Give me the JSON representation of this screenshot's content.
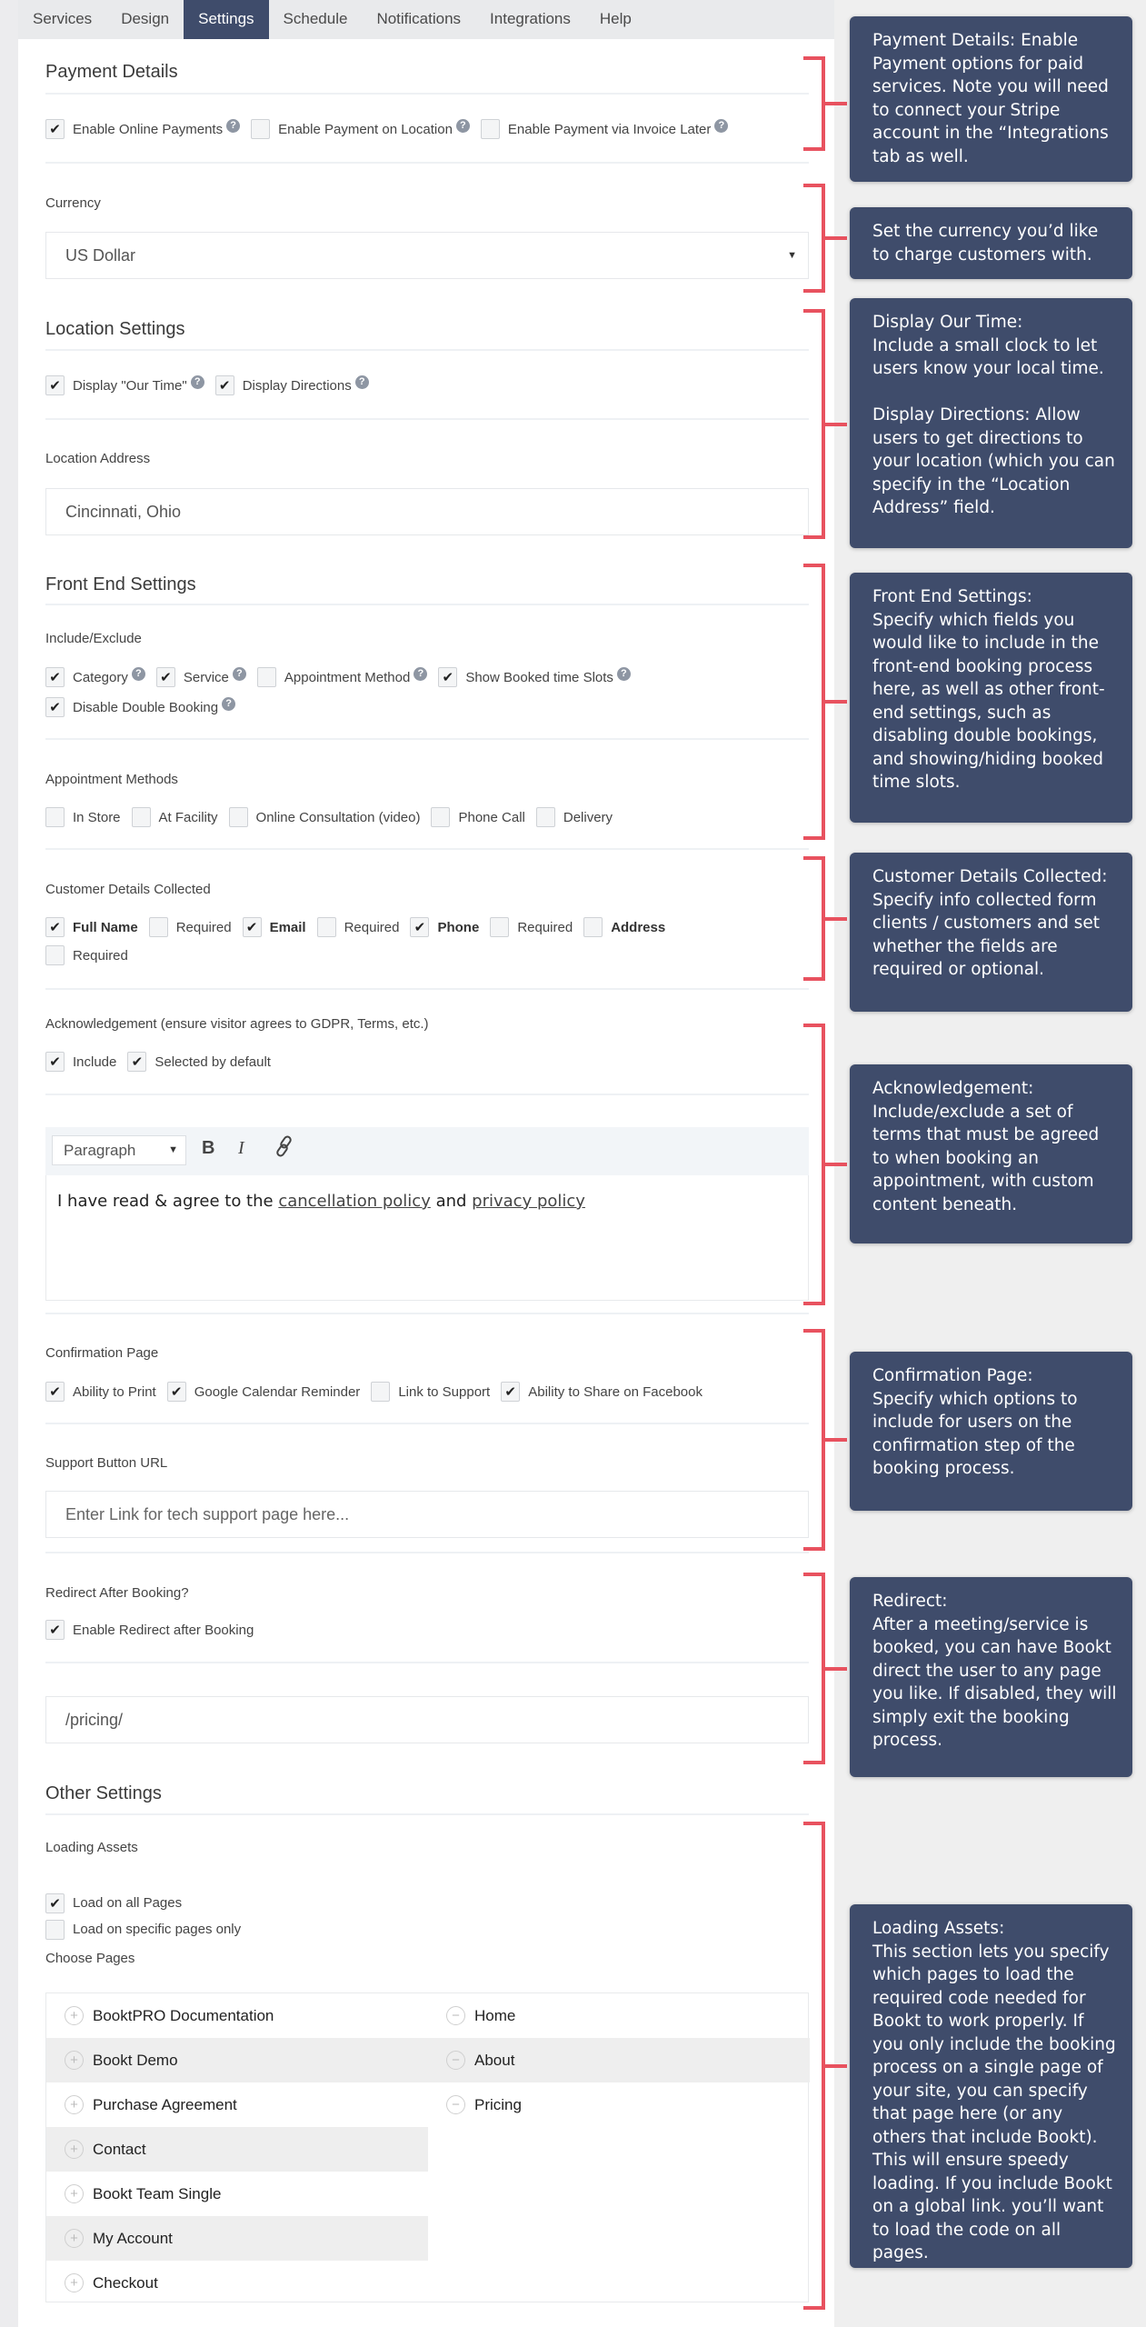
{
  "tabs": [
    {
      "label": "Services",
      "active": false
    },
    {
      "label": "Design",
      "active": false
    },
    {
      "label": "Settings",
      "active": true
    },
    {
      "label": "Schedule",
      "active": false
    },
    {
      "label": "Notifications",
      "active": false
    },
    {
      "label": "Integrations",
      "active": false
    },
    {
      "label": "Help",
      "active": false
    }
  ],
  "payment": {
    "title": "Payment Details",
    "options": [
      {
        "label": "Enable Online Payments",
        "checked": true,
        "help": true
      },
      {
        "label": "Enable Payment on Location",
        "checked": false,
        "help": true
      },
      {
        "label": "Enable Payment via Invoice Later",
        "checked": false,
        "help": true
      }
    ]
  },
  "currency": {
    "label": "Currency",
    "value": "US Dollar"
  },
  "location": {
    "title": "Location Settings",
    "options": [
      {
        "label": "Display \"Our Time\"",
        "checked": true,
        "help": true
      },
      {
        "label": "Display Directions",
        "checked": true,
        "help": true
      }
    ],
    "address_label": "Location Address",
    "address_value": "Cincinnati, Ohio"
  },
  "front_end": {
    "title": "Front End Settings",
    "include_label": "Include/Exclude",
    "include_row1": [
      {
        "label": "Category",
        "checked": true,
        "help": true
      },
      {
        "label": "Service",
        "checked": true,
        "help": true
      },
      {
        "label": "Appointment Method",
        "checked": false,
        "help": true
      },
      {
        "label": "Show Booked time Slots",
        "checked": true,
        "help": true
      }
    ],
    "include_row2": [
      {
        "label": "Disable Double Booking",
        "checked": true,
        "help": true
      }
    ],
    "methods_label": "Appointment Methods",
    "methods": [
      {
        "label": "In Store",
        "checked": false
      },
      {
        "label": "At Facility",
        "checked": false
      },
      {
        "label": "Online Consultation (video)",
        "checked": false
      },
      {
        "label": "Phone Call",
        "checked": false
      },
      {
        "label": "Delivery",
        "checked": false
      }
    ]
  },
  "customer": {
    "label": "Customer Details Collected",
    "row1": [
      {
        "label": "Full Name",
        "checked": true,
        "bold": true
      },
      {
        "label": "Required",
        "checked": false,
        "bold": false
      },
      {
        "label": "Email",
        "checked": true,
        "bold": true
      },
      {
        "label": "Required",
        "checked": false,
        "bold": false
      },
      {
        "label": "Phone",
        "checked": true,
        "bold": true
      },
      {
        "label": "Required",
        "checked": false,
        "bold": false
      },
      {
        "label": "Address",
        "checked": false,
        "bold": true
      }
    ],
    "row2": [
      {
        "label": "Required",
        "checked": false,
        "bold": false
      }
    ]
  },
  "acknowledgement": {
    "label": "Acknowledgement (ensure visitor agrees to GDPR, Terms, etc.)",
    "options": [
      {
        "label": "Include",
        "checked": true
      },
      {
        "label": "Selected by default",
        "checked": true
      }
    ],
    "editor": {
      "format_value": "Paragraph",
      "bold_label": "B",
      "italic_label": "I",
      "text_before": "I have read & agree to the ",
      "link1": "cancellation policy",
      "text_mid": " and ",
      "link2": "privacy policy"
    }
  },
  "confirmation": {
    "label": "Confirmation Page",
    "options": [
      {
        "label": "Ability to Print",
        "checked": true
      },
      {
        "label": "Google Calendar Reminder",
        "checked": true
      },
      {
        "label": "Link to Support",
        "checked": false
      },
      {
        "label": "Ability to Share on Facebook",
        "checked": true
      }
    ],
    "support_label": "Support Button URL",
    "support_placeholder": "Enter Link for tech support page here..."
  },
  "redirect": {
    "label": "Redirect After Booking?",
    "options": [
      {
        "label": "Enable Redirect after Booking",
        "checked": true
      }
    ],
    "url_value": "/pricing/"
  },
  "other": {
    "title": "Other Settings",
    "loading_label": "Loading Assets",
    "options": [
      {
        "label": "Load on all Pages",
        "checked": true
      },
      {
        "label": "Load on specific pages only",
        "checked": false
      }
    ],
    "choose_label": "Choose Pages",
    "available_pages": [
      "BooktPRO Documentation",
      "Bookt Demo",
      "Purchase Agreement",
      "Contact",
      "Bookt Team Single",
      "My Account",
      "Checkout"
    ],
    "selected_pages": [
      "Home",
      "About",
      "Pricing"
    ]
  },
  "callouts": [
    "Payment Details: Enable Payment options for paid services. Note you will need to connect your Stripe account in the “Integrations tab as well.",
    "Set the currency you’d like to charge customers with.",
    "Display Our Time:\nInclude a small clock to let users know your local time.\n\nDisplay Directions: Allow users to get directions to your location (which you can specify in the “Location Address” field.",
    "Front End Settings:\nSpecify which fields you would like to include in the front-end booking process here, as well as other front-end settings, such as disabling double bookings, and showing/hiding booked time slots.",
    "Customer Details Collected: Specify info collected form clients / customers and set whether the fields are required or optional.",
    "Acknowledgement:\nInclude/exclude a set of terms that must be agreed to when booking an appointment, with custom content beneath.",
    "Confirmation Page:\nSpecify which options to include for users on the confirmation step of the booking process.",
    "Redirect:\nAfter a meeting/service is booked, you can have Bookt direct the user to any page you like. If disabled, they will simply exit the booking process.",
    "Loading Assets:\nThis section lets you specify which pages to load the required code needed for Bookt to work properly. If you only include the booking process on a single page of your site, you can specify that page here (or any others that include Bookt). This will ensure speedy loading. If you include Bookt on a global link. you’ll want to load the code on all pages."
  ],
  "icons": {
    "check": "✔",
    "help": "?",
    "caret": "▼",
    "plus": "+",
    "minus": "−"
  },
  "colors": {
    "accent": "#3f4c6b",
    "bracket": "#e8525f"
  }
}
